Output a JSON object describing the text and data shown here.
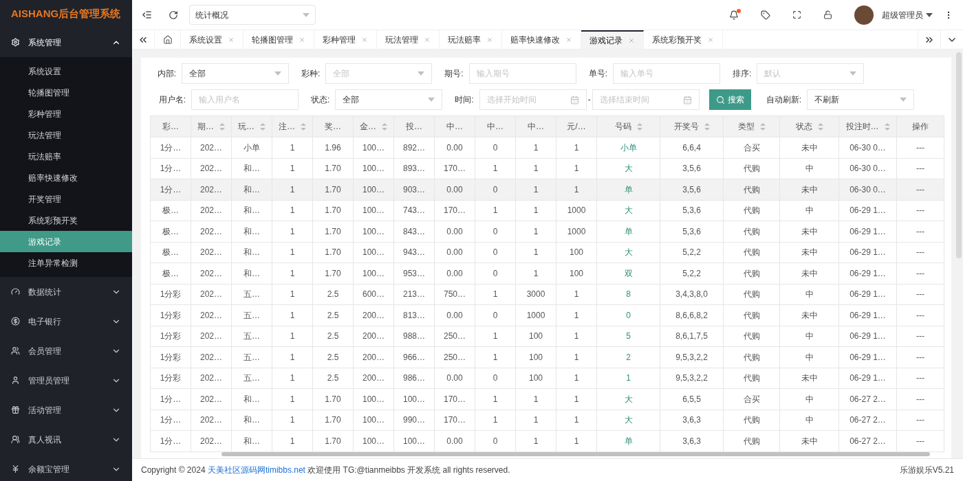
{
  "logo": "AISHANG后台管理系统",
  "sidebar": {
    "groups": [
      {
        "label": "系统管理",
        "expanded": true,
        "children": [
          {
            "label": "系统设置",
            "selected": false
          },
          {
            "label": "轮播图管理",
            "selected": false
          },
          {
            "label": "彩种管理",
            "selected": false
          },
          {
            "label": "玩法管理",
            "selected": false
          },
          {
            "label": "玩法赔率",
            "selected": false
          },
          {
            "label": "赔率快速修改",
            "selected": false
          },
          {
            "label": "开奖管理",
            "selected": false
          },
          {
            "label": "系统彩预开奖",
            "selected": false
          },
          {
            "label": "游戏记录",
            "selected": true
          },
          {
            "label": "注单异常检测",
            "selected": false
          }
        ]
      },
      {
        "label": "数据统计",
        "expanded": false
      },
      {
        "label": "电子银行",
        "expanded": false
      },
      {
        "label": "会员管理",
        "expanded": false
      },
      {
        "label": "管理员管理",
        "expanded": false
      },
      {
        "label": "活动管理",
        "expanded": false
      },
      {
        "label": "真人视讯",
        "expanded": false
      },
      {
        "label": "余额宝管理",
        "expanded": false
      }
    ]
  },
  "topbar": {
    "page_select": "统计概况",
    "notification_dot": true,
    "user": "超级管理员"
  },
  "tabs": [
    {
      "label": "系统设置",
      "selected": false
    },
    {
      "label": "轮播图管理",
      "selected": false
    },
    {
      "label": "彩种管理",
      "selected": false
    },
    {
      "label": "玩法管理",
      "selected": false
    },
    {
      "label": "玩法赔率",
      "selected": false
    },
    {
      "label": "赔率快速修改",
      "selected": false
    },
    {
      "label": "游戏记录",
      "selected": true
    },
    {
      "label": "系统彩预开奖",
      "selected": false
    }
  ],
  "filters": [
    [
      {
        "label": "内部:",
        "kind": "select",
        "value": "全部"
      },
      {
        "label": "彩种:",
        "kind": "select",
        "placeholder": "全部"
      },
      {
        "label": "期号:",
        "kind": "input",
        "placeholder": "输入期号"
      },
      {
        "label": "单号:",
        "kind": "input",
        "placeholder": "输入单号"
      },
      {
        "label": "排序:",
        "kind": "select",
        "placeholder": "默认"
      }
    ],
    [
      {
        "label": "用户名:",
        "kind": "input",
        "placeholder": "输入用户名"
      },
      {
        "label": "状态:",
        "kind": "select",
        "value": "全部"
      },
      {
        "label": "时间:",
        "kind": "daterange",
        "placeholder": "选择开始时间",
        "placeholder_end": "选择结束时间",
        "separator": "-"
      },
      {
        "kind": "button",
        "label": "搜索"
      },
      {
        "label": "自动刷新:",
        "kind": "select",
        "value": "不刷新"
      }
    ]
  ],
  "table": {
    "columns": [
      {
        "label": "彩…",
        "sortable": false,
        "kind": "text"
      },
      {
        "label": "期…",
        "sortable": true,
        "kind": "text"
      },
      {
        "label": "玩…",
        "sortable": true,
        "kind": "text"
      },
      {
        "label": "注…",
        "sortable": true,
        "kind": "text"
      },
      {
        "label": "奖…",
        "sortable": false,
        "kind": "text"
      },
      {
        "label": "金…",
        "sortable": true,
        "kind": "text"
      },
      {
        "label": "投…",
        "sortable": false,
        "kind": "text"
      },
      {
        "label": "中…",
        "sortable": false,
        "kind": "text"
      },
      {
        "label": "中…",
        "sortable": false,
        "kind": "text"
      },
      {
        "label": "中…",
        "sortable": false,
        "kind": "text"
      },
      {
        "label": "元/…",
        "sortable": false,
        "kind": "text"
      },
      {
        "label": "号码",
        "sortable": true,
        "kind": "code"
      },
      {
        "label": "开奖号",
        "sortable": true,
        "kind": "text"
      },
      {
        "label": "类型",
        "sortable": true,
        "kind": "text"
      },
      {
        "label": "状态",
        "sortable": true,
        "kind": "text"
      },
      {
        "label": "投注时…",
        "sortable": true,
        "kind": "text"
      },
      {
        "label": "操作",
        "sortable": false,
        "kind": "text"
      }
    ],
    "rows": [
      {
        "selected": false,
        "cells": [
          "1分…",
          "202…",
          "小单",
          "1",
          "1.96",
          "100…",
          "892…",
          "0.00",
          "0",
          "1",
          "1",
          "小单",
          "6,6,4",
          "合买",
          "未中",
          "06-30 0…",
          "---"
        ]
      },
      {
        "selected": false,
        "cells": [
          "1分…",
          "202…",
          "和…",
          "1",
          "1.70",
          "100…",
          "893…",
          "170…",
          "1",
          "1",
          "1",
          "大",
          "3,5,6",
          "代购",
          "中",
          "06-30 0…",
          "---"
        ]
      },
      {
        "selected": true,
        "cells": [
          "1分…",
          "202…",
          "和…",
          "1",
          "1.70",
          "100…",
          "903…",
          "0.00",
          "0",
          "1",
          "1",
          "单",
          "3,5,6",
          "代购",
          "未中",
          "06-30 0…",
          "---"
        ]
      },
      {
        "selected": false,
        "cells": [
          "极…",
          "202…",
          "和…",
          "1",
          "1.70",
          "100…",
          "743…",
          "170…",
          "1",
          "1",
          "1000",
          "大",
          "5,3,6",
          "代购",
          "中",
          "06-29 1…",
          "---"
        ]
      },
      {
        "selected": false,
        "cells": [
          "极…",
          "202…",
          "和…",
          "1",
          "1.70",
          "100…",
          "843…",
          "0.00",
          "0",
          "1",
          "1000",
          "单",
          "5,3,6",
          "代购",
          "未中",
          "06-29 1…",
          "---"
        ]
      },
      {
        "selected": false,
        "cells": [
          "极…",
          "202…",
          "和…",
          "1",
          "1.70",
          "100…",
          "943…",
          "0.00",
          "0",
          "1",
          "100",
          "大",
          "5,2,2",
          "代购",
          "未中",
          "06-29 1…",
          "---"
        ]
      },
      {
        "selected": false,
        "cells": [
          "极…",
          "202…",
          "和…",
          "1",
          "1.70",
          "100…",
          "953…",
          "0.00",
          "0",
          "1",
          "100",
          "双",
          "5,2,2",
          "代购",
          "未中",
          "06-29 1…",
          "---"
        ]
      },
      {
        "selected": false,
        "cells": [
          "1分彩",
          "202…",
          "五…",
          "1",
          "2.5",
          "600…",
          "213…",
          "750…",
          "1",
          "3000",
          "1",
          "8",
          "3,4,3,8,0",
          "代购",
          "中",
          "06-29 1…",
          "---"
        ]
      },
      {
        "selected": false,
        "cells": [
          "1分彩",
          "202…",
          "五…",
          "1",
          "2.5",
          "200…",
          "813…",
          "0.00",
          "0",
          "1000",
          "1",
          "0",
          "8,6,6,8,2",
          "代购",
          "未中",
          "06-29 1…",
          "---"
        ]
      },
      {
        "selected": false,
        "cells": [
          "1分彩",
          "202…",
          "五…",
          "1",
          "2.5",
          "200…",
          "988…",
          "250…",
          "1",
          "100",
          "1",
          "5",
          "8,6,1,7,5",
          "代购",
          "中",
          "06-29 1…",
          "---"
        ]
      },
      {
        "selected": false,
        "cells": [
          "1分彩",
          "202…",
          "五…",
          "1",
          "2.5",
          "200…",
          "966…",
          "250…",
          "1",
          "100",
          "1",
          "2",
          "9,5,3,2,2",
          "代购",
          "中",
          "06-29 1…",
          "---"
        ]
      },
      {
        "selected": false,
        "cells": [
          "1分彩",
          "202…",
          "五…",
          "1",
          "2.5",
          "200…",
          "986…",
          "0.00",
          "0",
          "100",
          "1",
          "1",
          "9,5,3,2,2",
          "代购",
          "未中",
          "06-29 1…",
          "---"
        ]
      },
      {
        "selected": false,
        "cells": [
          "1分…",
          "202…",
          "和…",
          "1",
          "1.70",
          "100…",
          "100…",
          "170…",
          "1",
          "1",
          "1",
          "大",
          "6,5,5",
          "合买",
          "中",
          "06-27 2…",
          "---"
        ]
      },
      {
        "selected": false,
        "cells": [
          "1分…",
          "202…",
          "和…",
          "1",
          "1.70",
          "100…",
          "990…",
          "170…",
          "1",
          "1",
          "1",
          "大",
          "3,6,3",
          "代购",
          "中",
          "06-27 2…",
          "---"
        ]
      },
      {
        "selected": false,
        "cells": [
          "1分…",
          "202…",
          "和…",
          "1",
          "1.70",
          "100…",
          "100…",
          "0.00",
          "0",
          "1",
          "1",
          "单",
          "3,6,3",
          "代购",
          "未中",
          "06-27 2…",
          "---"
        ]
      }
    ]
  },
  "footer": {
    "prefix": "Copyright © 2024",
    "link": "天美社区源码网timibbs.net",
    "suffix": "欢迎使用 TG:@tianmeibbs 开发系统 all rights reserved.",
    "version": "乐游娱乐V5.21"
  }
}
